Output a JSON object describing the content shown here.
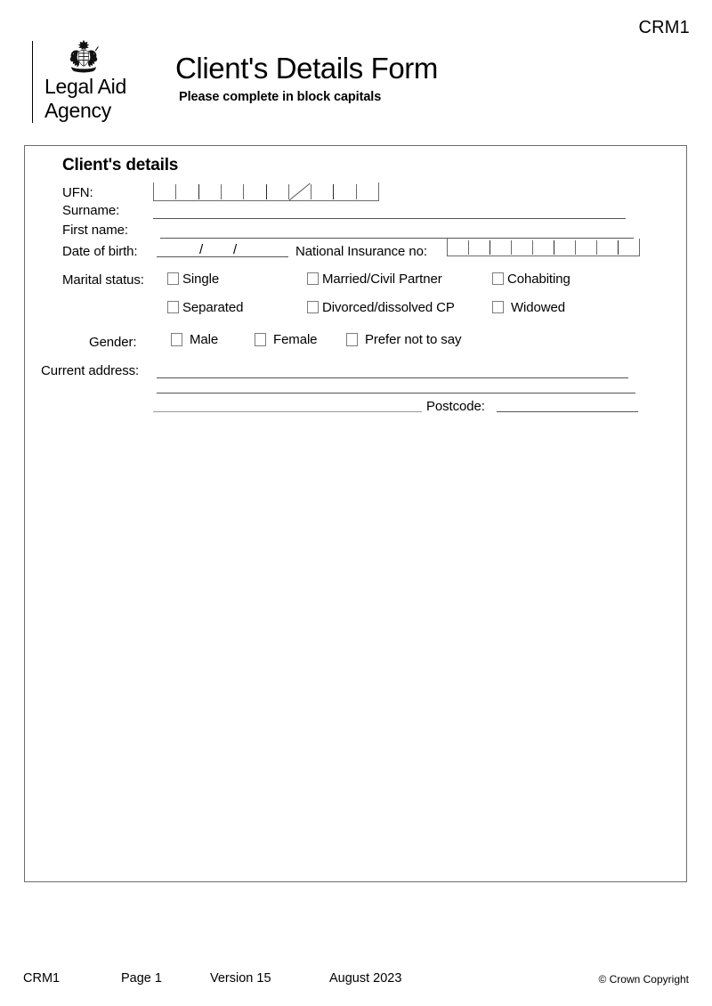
{
  "header": {
    "doc_code": "CRM1",
    "logo": {
      "icon": "royal-coat-of-arms-icon",
      "line1": "Legal Aid",
      "line2": "Agency"
    },
    "title": "Client's Details Form",
    "subtitle": "Please complete in block capitals"
  },
  "form": {
    "section_heading": "Client's details",
    "fields": {
      "ufn_label": "UFN:",
      "ufn_value": "",
      "ufn_cells": 10,
      "ufn_slash_cell": 7,
      "surname_label": "Surname:",
      "surname_value": "",
      "first_name_label": "First name:",
      "first_name_value": "",
      "dob_label": "Date of birth:",
      "dob_value": "",
      "dob_separator": "/",
      "ni_label": "National Insurance no:",
      "ni_value": "",
      "ni_cells": 9,
      "marital_label": "Marital status:",
      "gender_label": "Gender:",
      "address_label": "Current address:",
      "address_line1": "",
      "address_line2": "",
      "address_line3": "",
      "postcode_label": "Postcode:",
      "postcode_value": ""
    },
    "marital_options": [
      {
        "label": "Single",
        "checked": false
      },
      {
        "label": "Married/Civil Partner",
        "checked": false
      },
      {
        "label": "Cohabiting",
        "checked": false
      },
      {
        "label": "Separated",
        "checked": false
      },
      {
        "label": "Divorced/dissolved CP",
        "checked": false
      },
      {
        "label": "Widowed",
        "checked": false
      }
    ],
    "gender_options": [
      {
        "label": "Male",
        "checked": false
      },
      {
        "label": "Female",
        "checked": false
      },
      {
        "label": "Prefer not to say",
        "checked": false
      }
    ]
  },
  "footer": {
    "doc_code": "CRM1",
    "page": "Page 1",
    "version": "Version 15",
    "date": "August 2023",
    "copyright": "© Crown Copyright"
  },
  "colors": {
    "text": "#000000",
    "rule": "#555555",
    "rule_light": "#9a9a9a",
    "border": "#6e6e6e",
    "background": "#ffffff"
  }
}
